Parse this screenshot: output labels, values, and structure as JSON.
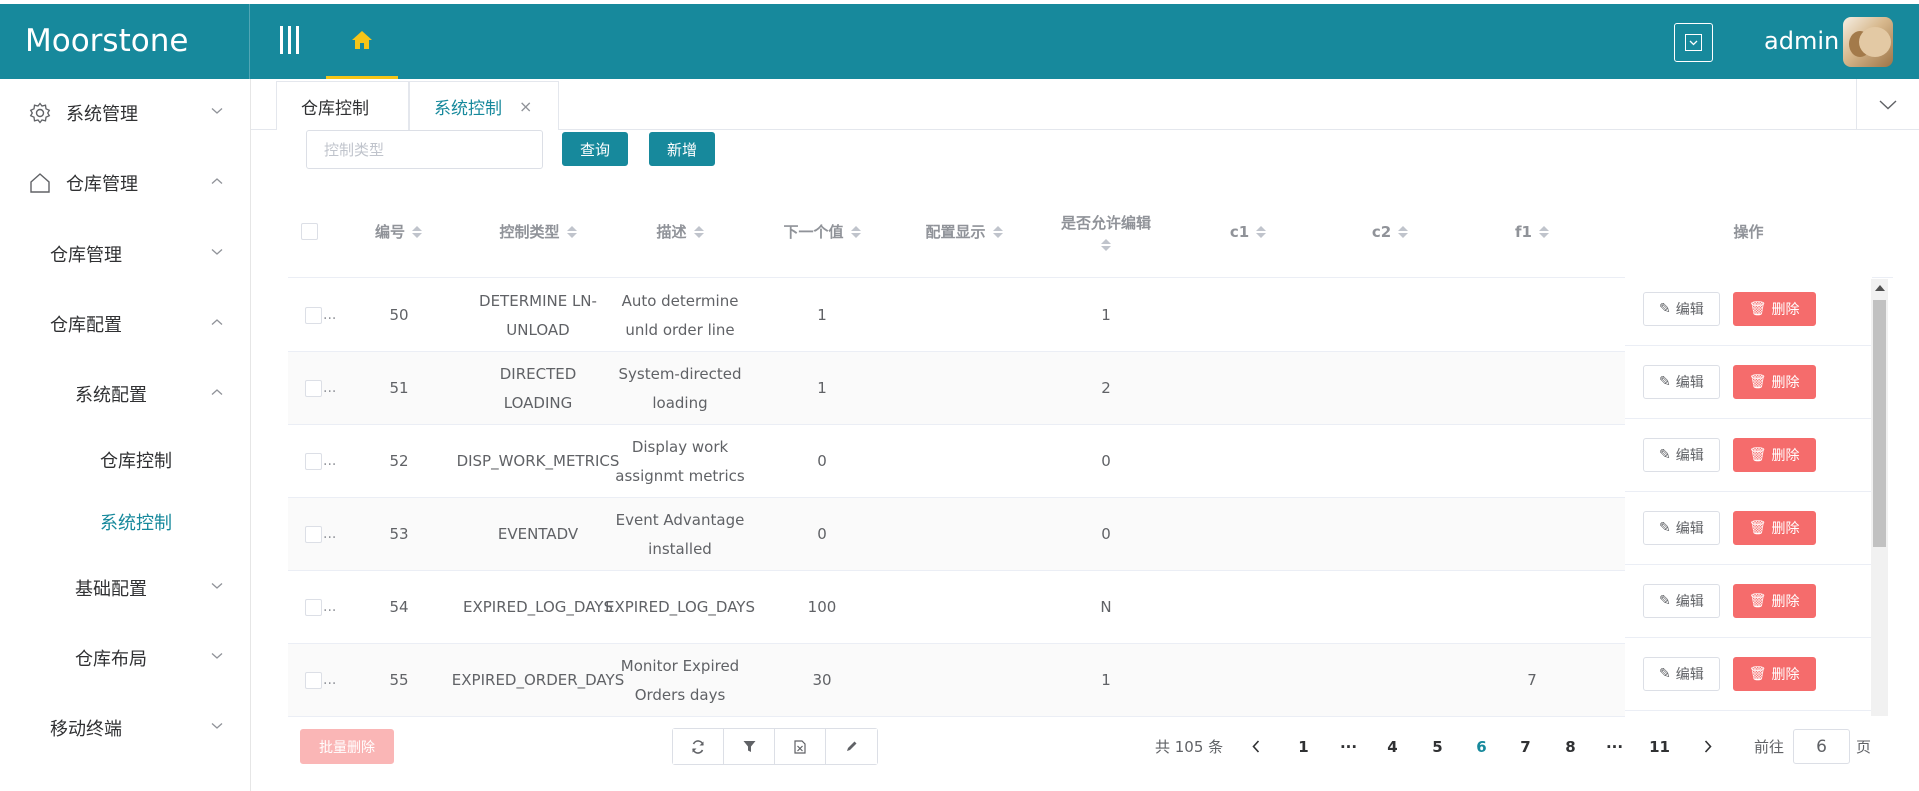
{
  "app": {
    "title": "Moorstone"
  },
  "header": {
    "username": "admin"
  },
  "sidebar": {
    "items": [
      {
        "label": "系统管理"
      },
      {
        "label": "仓库管理"
      },
      {
        "label": "仓库管理"
      },
      {
        "label": "仓库配置"
      },
      {
        "label": "系统配置"
      },
      {
        "label": "仓库控制"
      },
      {
        "label": "系统控制"
      },
      {
        "label": "基础配置"
      },
      {
        "label": "仓库布局"
      },
      {
        "label": "移动终端"
      }
    ]
  },
  "tabs": [
    {
      "label": "仓库控制"
    },
    {
      "label": "系统控制",
      "close": "×"
    }
  ],
  "toolbar": {
    "search_placeholder": "控制类型",
    "query_label": "查询",
    "add_label": "新增"
  },
  "table": {
    "columns": [
      "编号",
      "控制类型",
      "描述",
      "下一个值",
      "配置显示",
      "是否允许编辑",
      "c1",
      "c2",
      "f1",
      "操作"
    ],
    "rows": [
      {
        "id": "50",
        "type": "DETERMINE LN-UNLOAD",
        "desc": "Auto determine unld order line",
        "next": "1",
        "display": "",
        "editable": "1",
        "c1": "",
        "c2": "",
        "f1": ""
      },
      {
        "id": "51",
        "type": "DIRECTED LOADING",
        "desc": "System-directed loading",
        "next": "1",
        "display": "",
        "editable": "2",
        "c1": "",
        "c2": "",
        "f1": ""
      },
      {
        "id": "52",
        "type": "DISP_WORK_METRICS",
        "desc": "Display work assignmt metrics",
        "next": "0",
        "display": "",
        "editable": "0",
        "c1": "",
        "c2": "",
        "f1": ""
      },
      {
        "id": "53",
        "type": "EVENTADV",
        "desc": "Event Advantage installed",
        "next": "0",
        "display": "",
        "editable": "0",
        "c1": "",
        "c2": "",
        "f1": ""
      },
      {
        "id": "54",
        "type": "EXPIRED_LOG_DAYS",
        "desc": "EXPIRED_LOG_DAYS",
        "next": "100",
        "display": "",
        "editable": "N",
        "c1": "",
        "c2": "",
        "f1": ""
      },
      {
        "id": "55",
        "type": "EXPIRED_ORDER_DAYS",
        "desc": "Monitor Expired Orders days",
        "next": "30",
        "display": "",
        "editable": "1",
        "c1": "",
        "c2": "",
        "f1": "7"
      }
    ],
    "row_more": "...",
    "edit_label": "编辑",
    "delete_label": "删除"
  },
  "footer": {
    "batch_delete_label": "批量删除",
    "total_text": "共 105 条",
    "pages": [
      "1",
      "···",
      "4",
      "5",
      "6",
      "7",
      "8",
      "···",
      "11"
    ],
    "current_page": "6",
    "goto_prefix": "前往",
    "goto_value": "6",
    "goto_suffix": "页"
  },
  "colors": {
    "primary": "#17899c",
    "danger": "#f56c6c",
    "danger_disabled": "#fab6b6",
    "home_active": "#f5c518"
  },
  "icons": {
    "home": "home-icon",
    "gear": "gear-icon",
    "house-outline": "house-outline-icon",
    "edit": "edit-icon",
    "trash": "trash-icon",
    "refresh": "refresh-icon",
    "filter": "filter-icon",
    "export": "export-icon",
    "pencil": "pencil-icon"
  }
}
